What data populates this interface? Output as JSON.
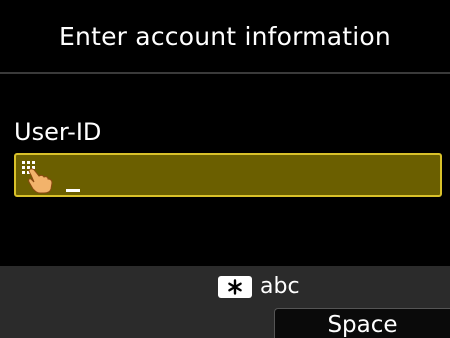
{
  "header": {
    "title": "Enter account information"
  },
  "form": {
    "field_label": "User-ID",
    "field_value": ""
  },
  "keypad_icon": "keypad-hand-icon",
  "input_mode": {
    "key_icon": "asterisk-key-icon",
    "label": "abc"
  },
  "buttons": {
    "space_label": "Space"
  },
  "colors": {
    "background": "#000000",
    "field_fill": "#6b5f00",
    "field_border": "#d9c12a",
    "bottom_bar": "#2b2b2b"
  }
}
